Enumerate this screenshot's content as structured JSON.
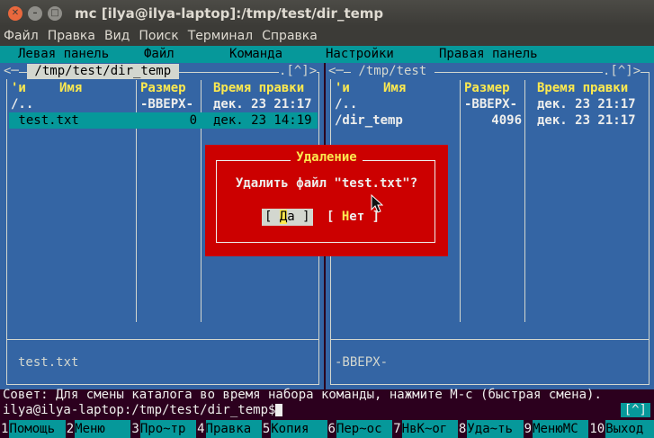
{
  "window": {
    "title": "mc [ilya@ilya-laptop]:/tmp/test/dir_temp"
  },
  "menubar": [
    "Файл",
    "Правка",
    "Вид",
    "Поиск",
    "Терминал",
    "Справка"
  ],
  "mc_menu": [
    "Левая панель",
    "Файл",
    "Команда",
    "Настройки",
    "Правая панель"
  ],
  "left_panel": {
    "title": " /tmp/test/dir_temp ",
    "corner_left": "<─",
    "corner_right": ".[^]>",
    "sort_marker": "'и",
    "col_name": "Имя",
    "col_size": "Размер",
    "col_time": "Время правки",
    "rows": [
      {
        "name": "/..",
        "size": "-ВВЕРХ-",
        "time": "дек. 23 21:17"
      },
      {
        "name": " test.txt",
        "size": "0",
        "time": "дек. 23 14:19"
      }
    ],
    "mini_status": "test.txt"
  },
  "right_panel": {
    "title": " /tmp/test ",
    "corner_left": "<─",
    "corner_right": ".[^]>",
    "sort_marker": "'и",
    "col_name": "Имя",
    "col_size": "Размер",
    "col_time": "Время правки",
    "rows": [
      {
        "name": "/..",
        "size": "-ВВЕРХ-",
        "time": "дек. 23 21:17"
      },
      {
        "name": "/dir_temp",
        "size": "4096",
        "time": "дек. 23 21:17"
      }
    ],
    "mini_status": "-ВВЕРХ-"
  },
  "dialog": {
    "title": "Удаление",
    "message": "Удалить файл \"test.txt\"?",
    "yes_open": "[ ",
    "yes_hot": "Д",
    "yes_rest": "а ]",
    "no_open": "[ ",
    "no_hot": "Н",
    "no_rest": "ет ]"
  },
  "hint": "Совет: Для смены каталога во время набора команды, нажмите M-c (быстрая смена).",
  "prompt": "ilya@ilya-laptop:/tmp/test/dir_temp$",
  "cmd_scroll": "[^]",
  "fkeys": [
    {
      "num": "1",
      "label": "Помощь"
    },
    {
      "num": "2",
      "label": "Меню"
    },
    {
      "num": "3",
      "label": "Про~тр"
    },
    {
      "num": "4",
      "label": "Правка"
    },
    {
      "num": "5",
      "label": "Копия"
    },
    {
      "num": "6",
      "label": "Пер~ос"
    },
    {
      "num": "7",
      "label": "НвК~ог"
    },
    {
      "num": "8",
      "label": "Уда~ть"
    },
    {
      "num": "9",
      "label": "МенюMC"
    },
    {
      "num": "10",
      "label": "Выход"
    }
  ],
  "colors": {
    "panel": "#3465a4",
    "selection": "#06989a",
    "dialog": "#cc0000",
    "header": "#fce94f"
  }
}
